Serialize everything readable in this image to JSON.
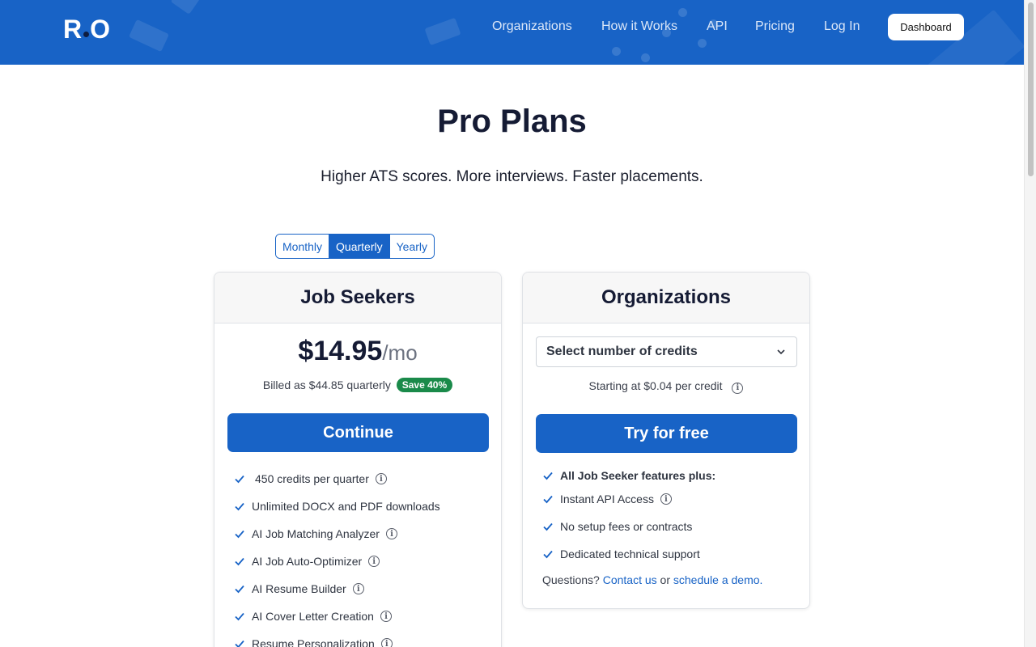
{
  "header": {
    "logo": {
      "left": "R",
      "right": "O"
    },
    "nav": [
      "Organizations",
      "How it Works",
      "API",
      "Pricing",
      "Log In"
    ],
    "dashboard_label": "Dashboard"
  },
  "hero": {
    "title": "Pro Plans",
    "subtitle": "Higher ATS scores. More interviews. Faster placements."
  },
  "billing_toggle": {
    "options": [
      "Monthly",
      "Quarterly",
      "Yearly"
    ],
    "selected": "Quarterly"
  },
  "job_seekers": {
    "title": "Job Seekers",
    "price": "$14.95",
    "price_unit": "/mo",
    "billed": "Billed as $44.85 quarterly",
    "badge": "Save 40%",
    "cta": "Continue",
    "features": [
      {
        "text": "450 credits per quarter",
        "info": true
      },
      {
        "text": "Unlimited DOCX and PDF downloads",
        "info": false
      },
      {
        "text": "AI Job Matching Analyzer",
        "info": true
      },
      {
        "text": "AI Job Auto-Optimizer",
        "info": true
      },
      {
        "text": "AI Resume Builder",
        "info": true
      },
      {
        "text": "AI Cover Letter Creation",
        "info": true
      },
      {
        "text": "Resume Personalization",
        "info": true
      }
    ]
  },
  "organizations": {
    "title": "Organizations",
    "select_placeholder": "Select number of credits",
    "starting": "Starting at $0.04 per credit",
    "cta": "Try for free",
    "features": [
      {
        "text": "All Job Seeker features plus:",
        "info": false,
        "bold": true
      },
      {
        "text": "Instant API Access",
        "info": true
      },
      {
        "text": "No setup fees or contracts",
        "info": false
      },
      {
        "text": "Dedicated technical support",
        "info": false
      }
    ],
    "questions_prefix": "Questions?",
    "contact_link": "Contact us",
    "or_text": "or",
    "demo_link": "schedule a demo."
  },
  "colors": {
    "brand": "#1863c6",
    "badge": "#1a8a4a",
    "title": "#151b34"
  },
  "icons": {
    "feature": "check-icon",
    "info": "info-icon",
    "select": "chevron-down-icon"
  }
}
